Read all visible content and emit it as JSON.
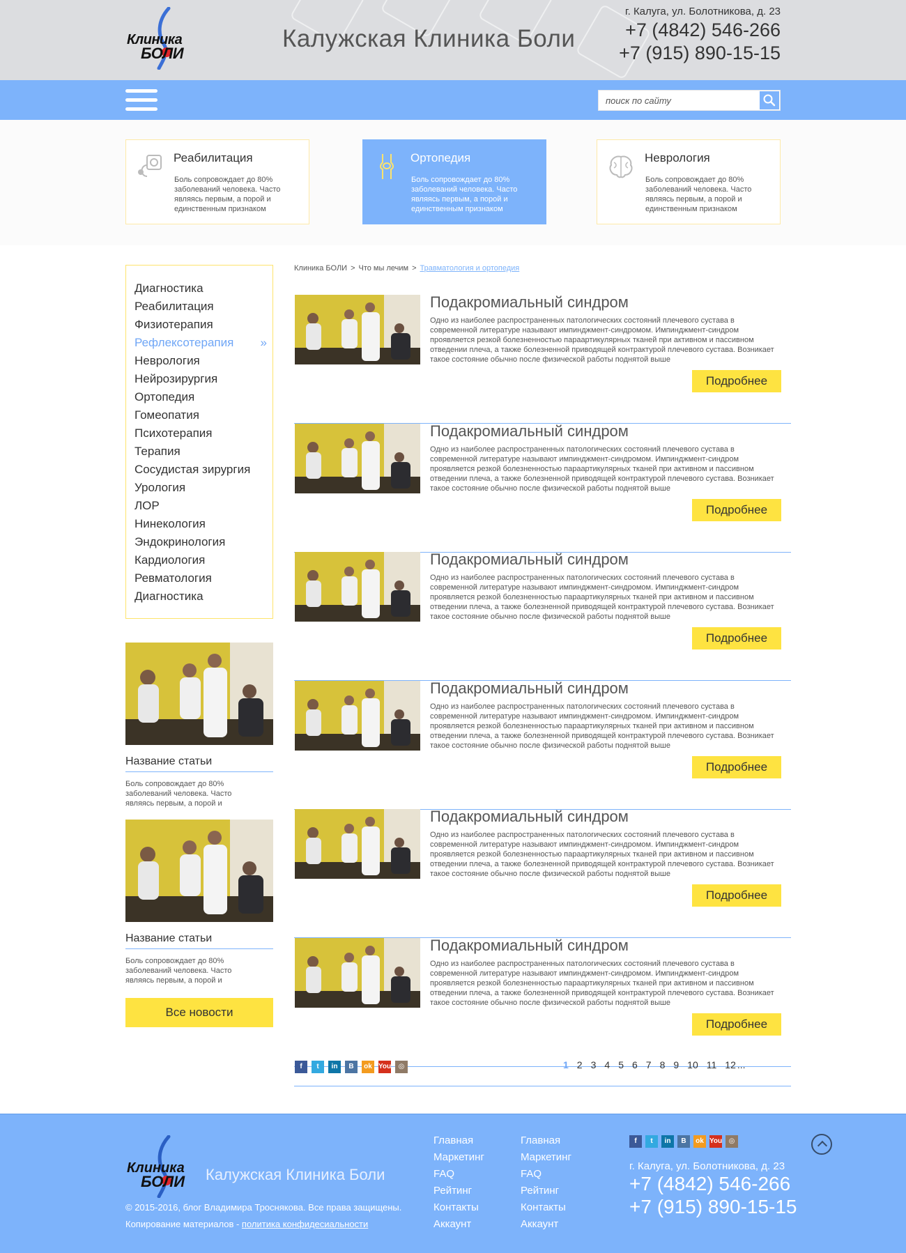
{
  "header": {
    "logo_line1": "Клиника",
    "logo_line2": "БОЛИ",
    "title": "Калужская Клиника Боли",
    "address": "г. Калуга, ул. Болотникова, д. 23",
    "phone1": "+7 (4842) 546-266",
    "phone2": "+7 (915) 890-15-15"
  },
  "search": {
    "placeholder": "поиск по сайту"
  },
  "cards": [
    {
      "title": "Реабилитация",
      "desc": "Боль сопровождает до 80% заболеваний человека. Часто являясь первым, а порой и единственным признаком"
    },
    {
      "title": "Ортопедия",
      "desc": "Боль сопровождает до 80% заболеваний человека. Часто являясь первым, а порой и единственным признаком"
    },
    {
      "title": "Неврология",
      "desc": "Боль сопровождает до 80% заболеваний человека. Часто являясь первым, а порой и единственным признаком"
    }
  ],
  "sidebar": {
    "menu": [
      "Диагностика",
      "Реабилитация",
      "Физиотерапия",
      "Рефлексотерапия",
      "Неврология",
      "Нейрозирургия",
      "Ортопедия",
      "Гомеопатия",
      "Психотерапия",
      "Терапия",
      "Сосудистая зирургия",
      "Урология",
      "ЛОР",
      "Нинекология",
      "Эндокринология",
      "Кардиология",
      "Ревматология",
      "Диагностика"
    ],
    "active_index": 3,
    "active_chevron": "»",
    "articles": [
      {
        "title": "Название статьи",
        "desc": "Боль сопровождает до 80% заболеваний человека. Часто являясь первым, а порой и"
      },
      {
        "title": "Название статьи",
        "desc": "Боль сопровождает до 80% заболеваний человека. Часто являясь первым, а порой и"
      }
    ],
    "all_news": "Все новости"
  },
  "breadcrumb": {
    "items": [
      "Клиника БОЛИ",
      "Что мы лечим",
      "Травматология и ортопедия"
    ],
    "separator": ">"
  },
  "articles": [
    {
      "title": "Подакромиальный синдром",
      "desc": "Одно из наиболее распространенных патологических состояний плечевого сустава в современной литературе называют импинджмент-синдромом. Импинджмент-синдром проявляется резкой болезненностью параартикулярных тканей при активном и пассивном  отведении плеча, а также болезненной приводящей контрактурой плечевого сустава. Возникает такое состояние обычно после физической работы поднятой выше",
      "more": "Подробнее"
    },
    {
      "title": "Подакромиальный синдром",
      "desc": "Одно из наиболее распространенных патологических состояний плечевого сустава в современной литературе называют импинджмент-синдромом. Импинджмент-синдром проявляется резкой болезненностью параартикулярных тканей при активном и пассивном  отведении плеча, а также болезненной приводящей контрактурой плечевого сустава. Возникает такое состояние обычно после физической работы поднятой выше",
      "more": "Подробнее"
    },
    {
      "title": "Подакромиальный синдром",
      "desc": "Одно из наиболее распространенных патологических состояний плечевого сустава в современной литературе называют импинджмент-синдромом. Импинджмент-синдром проявляется резкой болезненностью параартикулярных тканей при активном и пассивном  отведении плеча, а также болезненной приводящей контрактурой плечевого сустава. Возникает такое состояние обычно после физической работы поднятой выше",
      "more": "Подробнее"
    },
    {
      "title": "Подакромиальный синдром",
      "desc": "Одно из наиболее распространенных патологических состояний плечевого сустава в современной литературе называют импинджмент-синдромом. Импинджмент-синдром проявляется резкой болезненностью параартикулярных тканей при активном и пассивном  отведении плеча, а также болезненной приводящей контрактурой плечевого сустава. Возникает такое состояние обычно после физической работы поднятой выше",
      "more": "Подробнее"
    },
    {
      "title": "Подакромиальный синдром",
      "desc": "Одно из наиболее распространенных патологических состояний плечевого сустава в современной литературе называют импинджмент-синдромом. Импинджмент-синдром проявляется резкой болезненностью параартикулярных тканей при активном и пассивном  отведении плеча, а также болезненной приводящей контрактурой плечевого сустава. Возникает такое состояние обычно после физической работы поднятой выше",
      "more": "Подробнее"
    },
    {
      "title": "Подакромиальный синдром",
      "desc": "Одно из наиболее распространенных патологических состояний плечевого сустава в современной литературе называют импинджмент-синдромом. Импинджмент-синдром проявляется резкой болезненностью параартикулярных тканей при активном и пассивном  отведении плеча, а также болезненной приводящей контрактурой плечевого сустава. Возникает такое состояние обычно после физической работы поднятой выше",
      "more": "Подробнее"
    }
  ],
  "social": [
    {
      "name": "facebook-icon",
      "glyph": "f",
      "color": "#3b5998"
    },
    {
      "name": "twitter-icon",
      "glyph": "t",
      "color": "#33a9e0"
    },
    {
      "name": "linkedin-icon",
      "glyph": "in",
      "color": "#0e76a8"
    },
    {
      "name": "vk-icon",
      "glyph": "B",
      "color": "#4c75a3"
    },
    {
      "name": "odnoklassniki-icon",
      "glyph": "ok",
      "color": "#f39b1f"
    },
    {
      "name": "youtube-icon",
      "glyph": "You",
      "color": "#d5301c"
    },
    {
      "name": "instagram-icon",
      "glyph": "◎",
      "color": "#8f7a66"
    }
  ],
  "pagination": {
    "pages": [
      "1",
      "2",
      "3",
      "4",
      "5",
      "6",
      "7",
      "8",
      "9",
      "10",
      "11",
      "12",
      "..."
    ],
    "current": "1"
  },
  "footer": {
    "logo_line1": "Клиника",
    "logo_line2": "БОЛИ",
    "title": "Калужская Клиника Боли",
    "copyright": "© 2015-2016, блог Владимира Тросняковa. Все права защищены.",
    "copy_text": "Копирование материалов - ",
    "policy_link": "политика конфидесиальности",
    "col1": [
      "Главная",
      "Маркетинг",
      "FAQ",
      "Рейтинг",
      "Контакты",
      "Аккаунт"
    ],
    "col2": [
      "Главная",
      "Маркетинг",
      "FAQ",
      "Рейтинг",
      "Контакты",
      "Аккаунт"
    ],
    "address": "г. Калуга, ул. Болотникова, д. 23",
    "phone1": "+7 (4842) 546-266",
    "phone2": "+7 (915) 890-15-15"
  },
  "colors": {
    "accent_blue": "#7db3fb",
    "accent_yellow": "#fee341",
    "active_link": "#6fa6f6"
  }
}
